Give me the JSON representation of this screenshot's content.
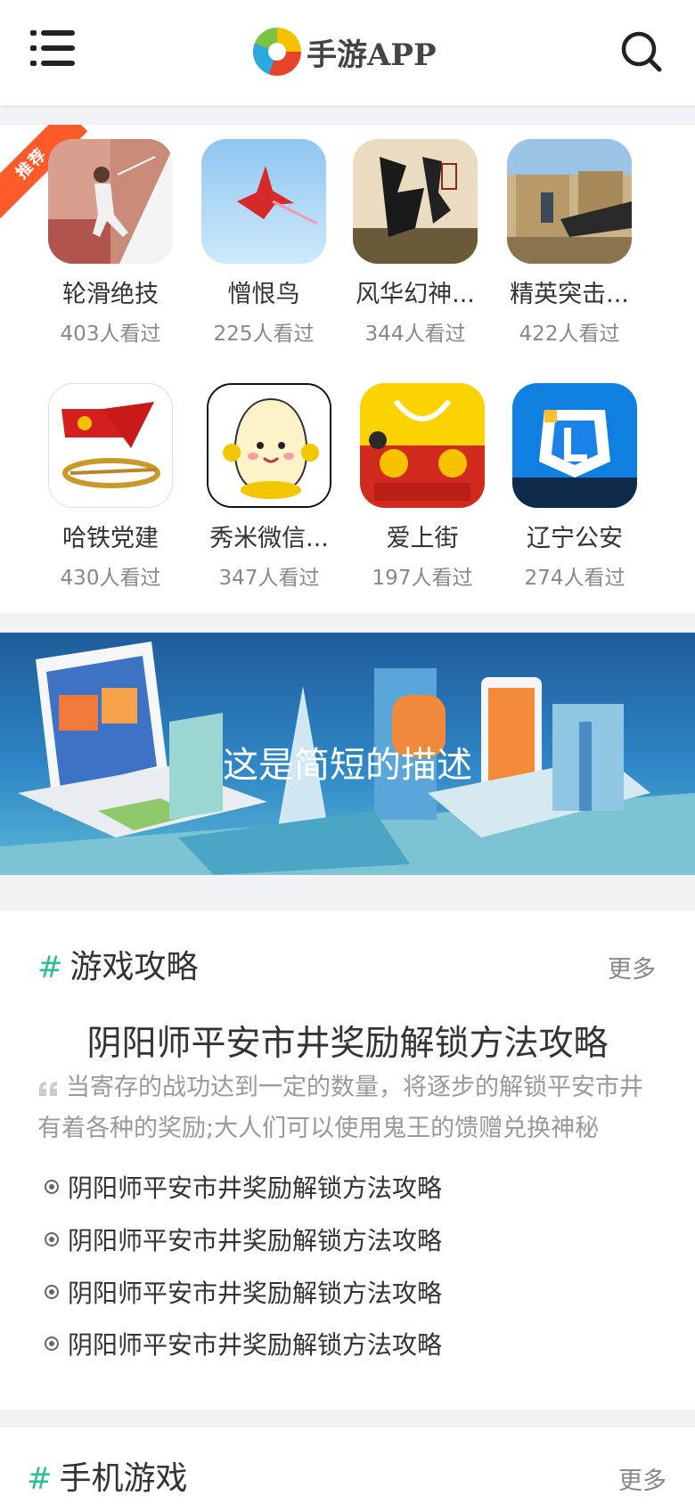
{
  "header": {
    "brand": "手游APP"
  },
  "recommend": {
    "badge": "推荐",
    "apps": [
      {
        "name": "轮滑绝技",
        "views": "403人看过"
      },
      {
        "name": "憎恨鸟",
        "views": "225人看过"
      },
      {
        "name": "风华幻神...",
        "views": "344人看过"
      },
      {
        "name": "精英突击...",
        "views": "422人看过"
      },
      {
        "name": "哈铁党建",
        "views": "430人看过"
      },
      {
        "name": "秀米微信...",
        "views": "347人看过"
      },
      {
        "name": "爱上街",
        "views": "197人看过"
      },
      {
        "name": "辽宁公安",
        "views": "274人看过"
      }
    ]
  },
  "banner": {
    "caption": "这是简短的描述"
  },
  "guide": {
    "hash": "#",
    "title": "游戏攻略",
    "more": "更多",
    "feature_title": "阴阳师平安市井奖励解锁方法攻略",
    "feature_summary": "当寄存的战功达到一定的数量，将逐步的解锁平安市井有着各种的奖励;大人们可以使用鬼王的馈赠兑换神秘",
    "links": [
      "阴阳师平安市井奖励解锁方法攻略",
      "阴阳师平安市井奖励解锁方法攻略",
      "阴阳师平安市井奖励解锁方法攻略",
      "阴阳师平安市井奖励解锁方法攻略"
    ]
  },
  "games": {
    "hash": "#",
    "title": "手机游戏",
    "more": "更多"
  }
}
